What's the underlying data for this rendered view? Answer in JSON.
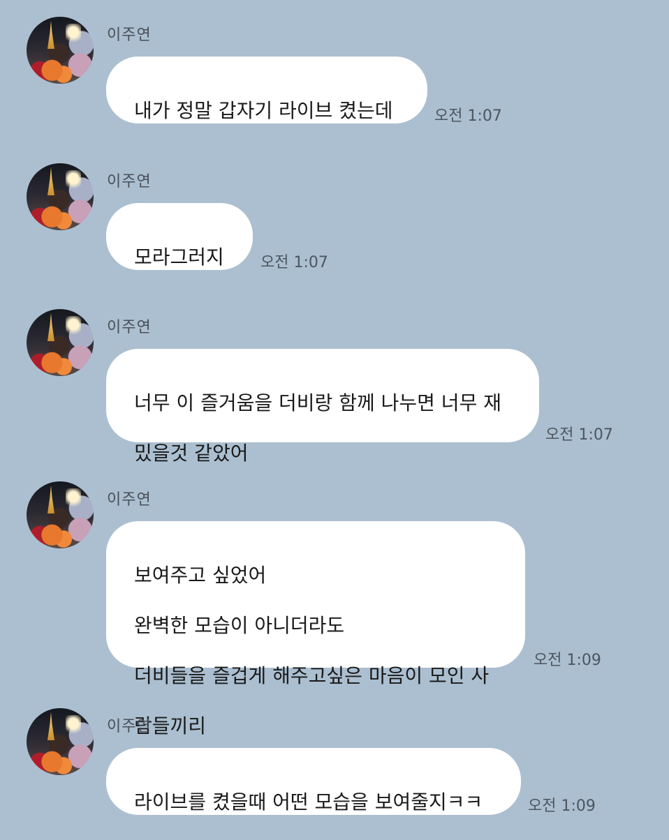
{
  "messages": [
    {
      "sender": "이주연",
      "lines": [
        "내가 정말 갑자기 라이브 켰는데"
      ],
      "time": "오전 1:07"
    },
    {
      "sender": "이주연",
      "lines": [
        "모라그러지"
      ],
      "time": "오전 1:07"
    },
    {
      "sender": "이주연",
      "lines": [
        "너무 이 즐거움을 더비랑 함께 나누면 너무 재",
        "밌을것 같았어"
      ],
      "time": "오전 1:07"
    },
    {
      "sender": "이주연",
      "lines": [
        "보여주고 싶었어",
        "완벽한 모습이 아니더라도",
        "더비들을 즐겁게 해주고싶은 마음이 모인 사",
        "람들끼리"
      ],
      "time": "오전 1:09"
    },
    {
      "sender": "이주연",
      "lines": [
        "라이브를 켰을때 어떤 모습을 보여줄지ㅋㅋ"
      ],
      "time": "오전 1:09"
    }
  ],
  "colors": {
    "background": "#abbfd0",
    "bubble": "#ffffff",
    "text": "#191919",
    "meta_text": "#4e5560"
  },
  "icons": {
    "avatar": "profile-photo"
  }
}
